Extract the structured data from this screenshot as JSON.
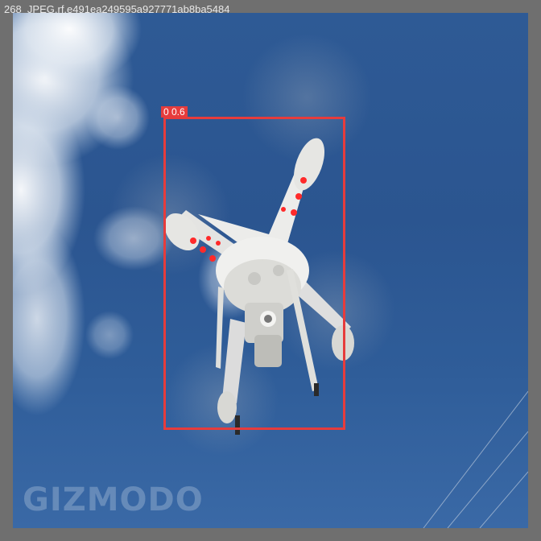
{
  "filename": "268_JPEG.rf.e491ea249595a927771ab8ba5484",
  "watermark": "GIZMODO",
  "detection": {
    "label": "0 0.6",
    "class_id": "0",
    "confidence": 0.6,
    "color": "#e63c3c"
  },
  "colors": {
    "frame": "#6f6f6f",
    "sky": "#2e5a95",
    "drone_body": "#e8e8e4",
    "drone_leds": "#ff2a2a"
  }
}
